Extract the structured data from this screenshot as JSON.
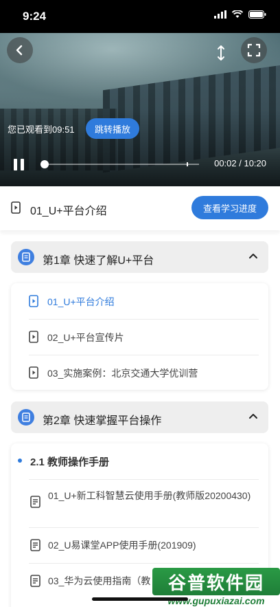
{
  "status_bar": {
    "time": "9:24"
  },
  "video": {
    "watched_text": "您已观看到09:51",
    "jump_label": "跳转播放",
    "time_display": "00:02 / 10:20",
    "progress_fraction": 0.003,
    "marker_fraction": 0.92
  },
  "lesson_header": {
    "title": "01_U+平台介绍",
    "progress_button": "查看学习进度"
  },
  "chapters": [
    {
      "title": "第1章 快速了解U+平台",
      "lessons": [
        {
          "label": "01_U+平台介绍",
          "active": true
        },
        {
          "label": "02_U+平台宣传片",
          "active": false
        },
        {
          "label": "03_实施案例：北京交通大学优训营",
          "active": false
        }
      ]
    },
    {
      "title": "第2章 快速掌握平台操作",
      "section": "2.1 教师操作手册",
      "docs": [
        {
          "label": "01_U+新工科智慧云使用手册(教师版20200430)"
        },
        {
          "label": "02_U易课堂APP使用手册(201909)"
        },
        {
          "label": "03_华为云使用指南（教"
        }
      ]
    }
  ],
  "watermark": {
    "brand": "谷普软件园",
    "url": "www.gupuxiazai.com"
  }
}
